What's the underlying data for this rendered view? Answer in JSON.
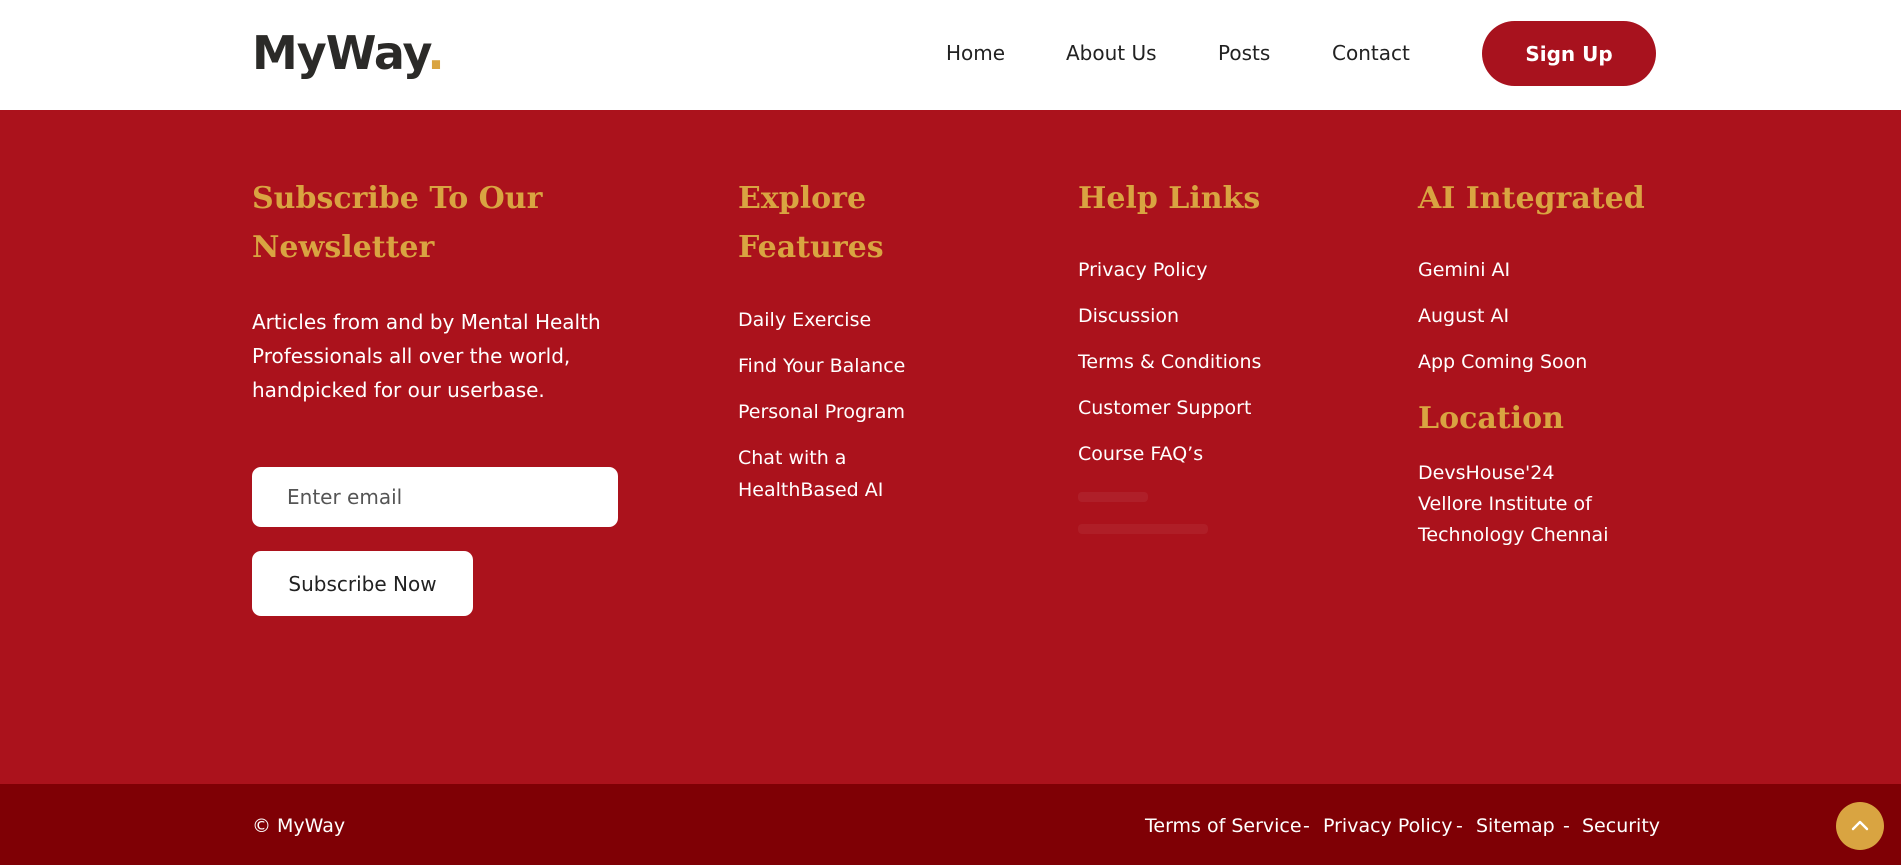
{
  "header": {
    "logo_text": "MyWay",
    "logo_dot": ".",
    "nav": [
      "Home",
      "About Us",
      "Posts",
      "Contact"
    ],
    "signup_label": "Sign Up"
  },
  "newsletter": {
    "heading_line1": "Subscribe To Our",
    "heading_line2": "Newsletter",
    "description_lines": [
      "Articles from and by Mental Health",
      "Professionals all over the world,",
      "handpicked for our userbase."
    ],
    "email_placeholder": "Enter email",
    "subscribe_label": "Subscribe Now"
  },
  "explore": {
    "heading_line1": "Explore",
    "heading_line2": "Features",
    "items": [
      "Daily Exercise",
      "Find Your Balance",
      "Personal Program"
    ],
    "chat_line1": "Chat with a",
    "chat_line2": "HealthBased AI"
  },
  "help": {
    "heading": "Help Links",
    "items": [
      "Privacy Policy",
      "Discussion",
      "Terms & Conditions",
      "Customer Support",
      "Course FAQ’s"
    ]
  },
  "ai": {
    "heading": "AI Integrated",
    "items": [
      "Gemini AI",
      "August AI",
      "App Coming Soon"
    ]
  },
  "location": {
    "heading": "Location",
    "lines": [
      "DevsHouse'24",
      "Vellore Institute of",
      "Technology Chennai"
    ]
  },
  "footer": {
    "copyright": "© MyWay",
    "links": [
      "Terms of Service",
      "Privacy Policy",
      "Sitemap",
      "Security"
    ],
    "separator": "-"
  },
  "colors": {
    "brand_red": "#ab121c",
    "dark_red": "#7f0005",
    "gold": "#d9a441"
  }
}
